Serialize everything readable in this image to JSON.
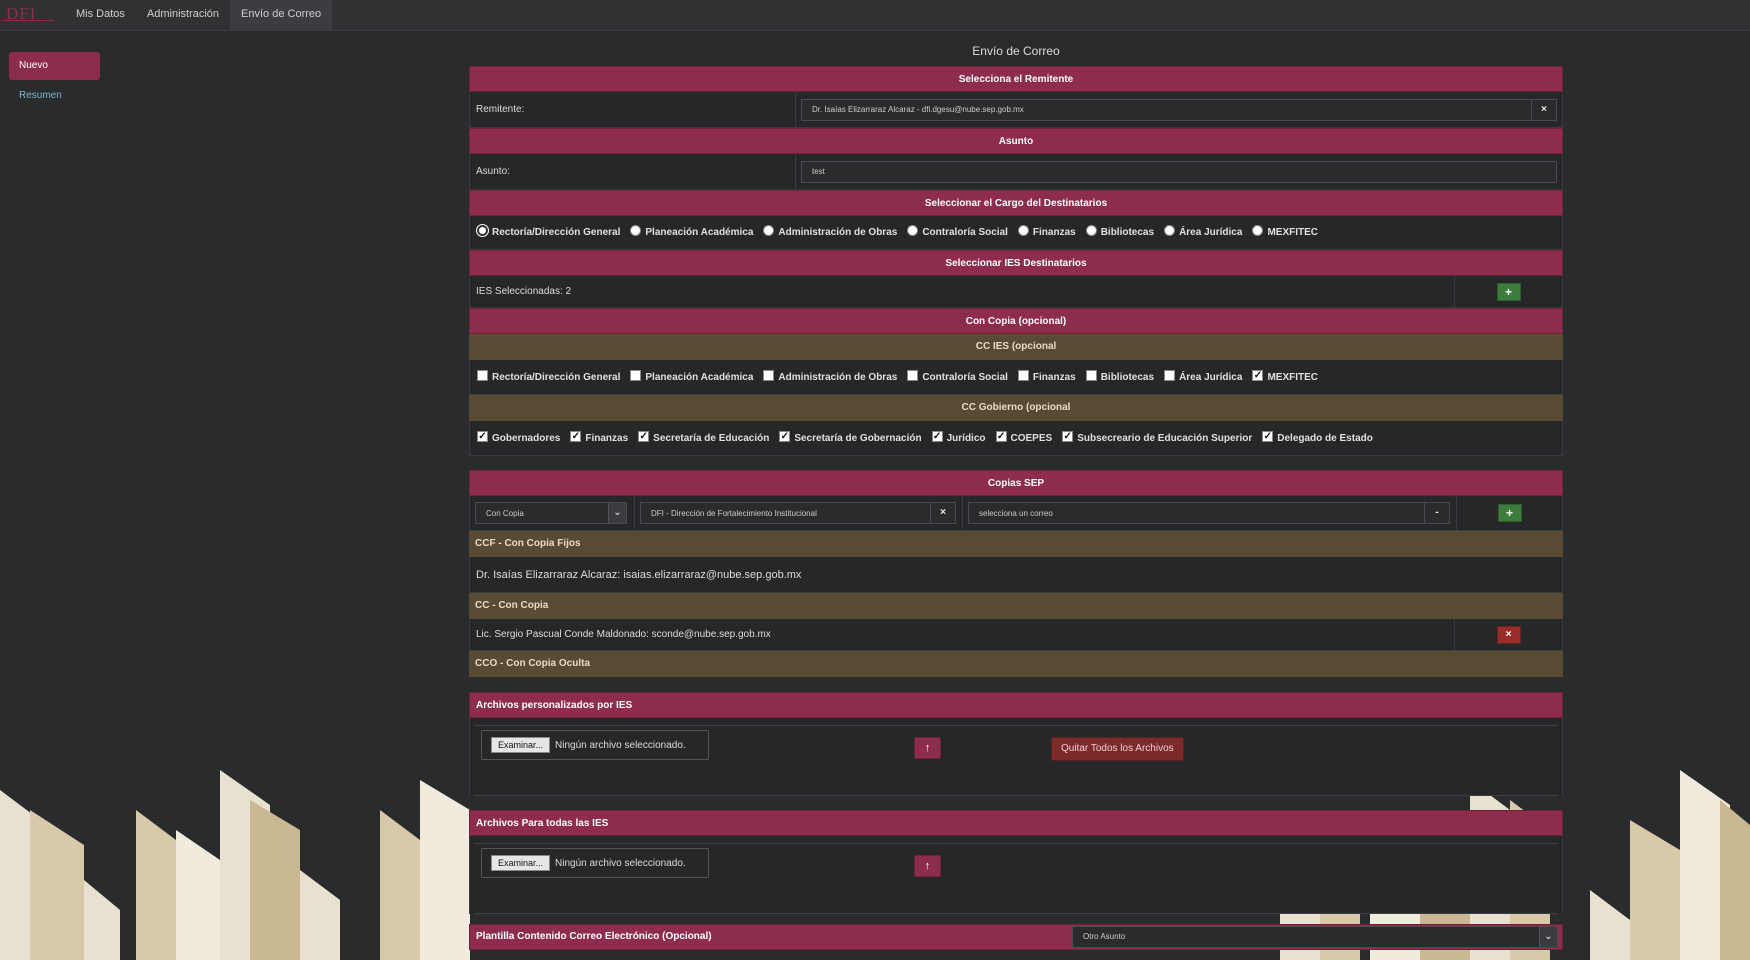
{
  "navbar": {
    "brand": "DFI",
    "items": [
      "Mis Datos",
      "Administración",
      "Envío de Correo"
    ],
    "active_index": 2
  },
  "sidebar": {
    "nuevo": "Nuevo",
    "resumen": "Resumen"
  },
  "page_title": "Envío de Correo",
  "remitente": {
    "header": "Selecciona el Remitente",
    "label": "Remitente:",
    "value": "Dr. Isaías Elizarraraz Alcaraz - dfi.dgesu@nube.sep.gob.mx",
    "clear": "×"
  },
  "asunto": {
    "header": "Asunto",
    "label": "Asunto:",
    "value": "test"
  },
  "cargo": {
    "header": "Seleccionar el Cargo del Destinatarios",
    "options": [
      "Rectoría/Dirección General",
      "Planeación Académica",
      "Administración de Obras",
      "Contraloría Social",
      "Finanzas",
      "Bibliotecas",
      "Área Jurídica",
      "MEXFITEC"
    ],
    "selected_index": 0
  },
  "ies": {
    "header": "Seleccionar IES Destinatarios",
    "count_label": "IES Seleccionadas: 2",
    "add": "+"
  },
  "con_copia": {
    "header": "Con Copia (opcional)",
    "cc_ies_header": "CC IES (opcional",
    "cc_ies_options": [
      {
        "label": "Rectoría/Dirección General",
        "checked": false
      },
      {
        "label": "Planeación Académica",
        "checked": false
      },
      {
        "label": "Administración de Obras",
        "checked": false
      },
      {
        "label": "Contraloría Social",
        "checked": false
      },
      {
        "label": "Finanzas",
        "checked": false
      },
      {
        "label": "Bibliotecas",
        "checked": false
      },
      {
        "label": "Área Jurídica",
        "checked": false
      },
      {
        "label": "MEXFITEC",
        "checked": true
      }
    ],
    "cc_gob_header": "CC Gobierno (opcional",
    "cc_gob_options": [
      {
        "label": "Gobernadores",
        "checked": true
      },
      {
        "label": "Finanzas",
        "checked": true
      },
      {
        "label": "Secretaría de Educación",
        "checked": true
      },
      {
        "label": "Secretaría de Gobernación",
        "checked": true
      },
      {
        "label": "Jurídico",
        "checked": true
      },
      {
        "label": "COEPES",
        "checked": true
      },
      {
        "label": "Subsecreario de Educación Superior",
        "checked": true
      },
      {
        "label": "Delegado de Estado",
        "checked": true
      }
    ]
  },
  "copias_sep": {
    "header": "Copias SEP",
    "tipo": "Con Copia",
    "direccion": "DFI - Dirección de Fortalecimiento Institucional",
    "correo_placeholder": "selecciona un correo",
    "add": "+",
    "ccf_header": "CCF - Con Copia Fijos",
    "ccf_entry": "Dr. Isaías Elizarraraz Alcaraz: isaias.elizarraraz@nube.sep.gob.mx",
    "cc_header": "CC - Con Copia",
    "cc_entry": "Lic. Sergio Pascual Conde Maldonado: sconde@nube.sep.gob.mx",
    "remove": "×",
    "cco_header": "CCO - Con Copia Oculta"
  },
  "archivos_ies": {
    "header": "Archivos personalizados por IES",
    "browse": "Examinar...",
    "no_file": "Ningún archivo seleccionado.",
    "upload": "↑",
    "remove_all": "Quitar Todos los Archivos"
  },
  "archivos_todas": {
    "header": "Archivos Para todas las IES",
    "browse": "Examinar...",
    "no_file": "Ningún archivo seleccionado.",
    "upload": "↑"
  },
  "plantilla": {
    "header": "Plantilla Contenido Correo Electrónico (Opcional)",
    "selected": "Otro Asunto"
  },
  "colors": {
    "accent": "#8e2d4b",
    "sub_header": "#594b33",
    "background": "#2a2b2d",
    "add_button": "#3e7c3e",
    "remove_button": "#9b2c2c"
  }
}
